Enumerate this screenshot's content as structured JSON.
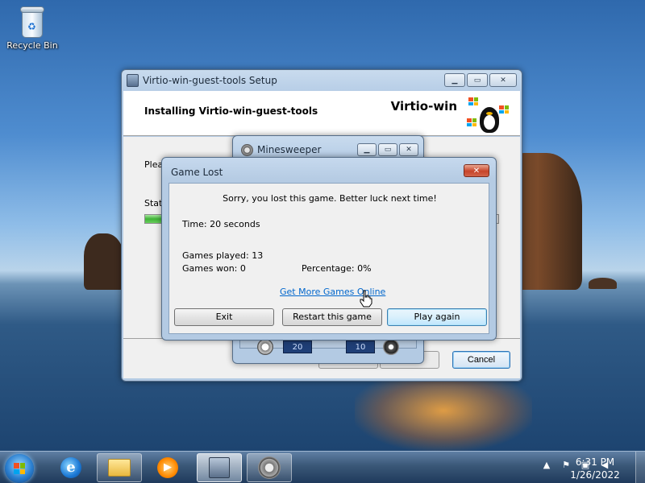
{
  "desktop": {
    "icons": [
      {
        "label": "Recycle Bin",
        "icon": "recycle-bin-icon"
      }
    ]
  },
  "setup_window": {
    "title": "Virtio-win-guest-tools Setup",
    "header_title": "Installing Virtio-win-guest-tools",
    "brand": "Virtio-win",
    "body_text_partial": "Pleas",
    "status_label_partial": "Stat",
    "progress_fraction": 0.06,
    "cancel_label": "Cancel"
  },
  "minesweeper_window": {
    "title": "Minesweeper",
    "time_counter": "20",
    "mines_counter": "10"
  },
  "game_lost_dialog": {
    "title": "Game Lost",
    "message": "Sorry, you lost this game. Better luck next time!",
    "time": "Time: 20 seconds",
    "games_played": "Games played: 13",
    "games_won": "Games won: 0",
    "percentage": "Percentage: 0%",
    "link": "Get More Games Online",
    "buttons": {
      "exit": "Exit",
      "restart": "Restart this game",
      "play_again": "Play again"
    }
  },
  "taskbar": {
    "items": [
      {
        "name": "internet-explorer",
        "icon": "ie-icon",
        "glyph": "e"
      },
      {
        "name": "windows-explorer",
        "icon": "folder-icon"
      },
      {
        "name": "media-player",
        "icon": "media-player-icon",
        "glyph": "▶"
      },
      {
        "name": "setup",
        "icon": "installer-icon"
      },
      {
        "name": "minesweeper",
        "icon": "minesweeper-icon"
      }
    ],
    "tray": {
      "arrow": "▲",
      "flag": "⚑",
      "network": "▣",
      "volume": "◀"
    },
    "time": "6:31 PM",
    "date": "1/26/2022"
  }
}
